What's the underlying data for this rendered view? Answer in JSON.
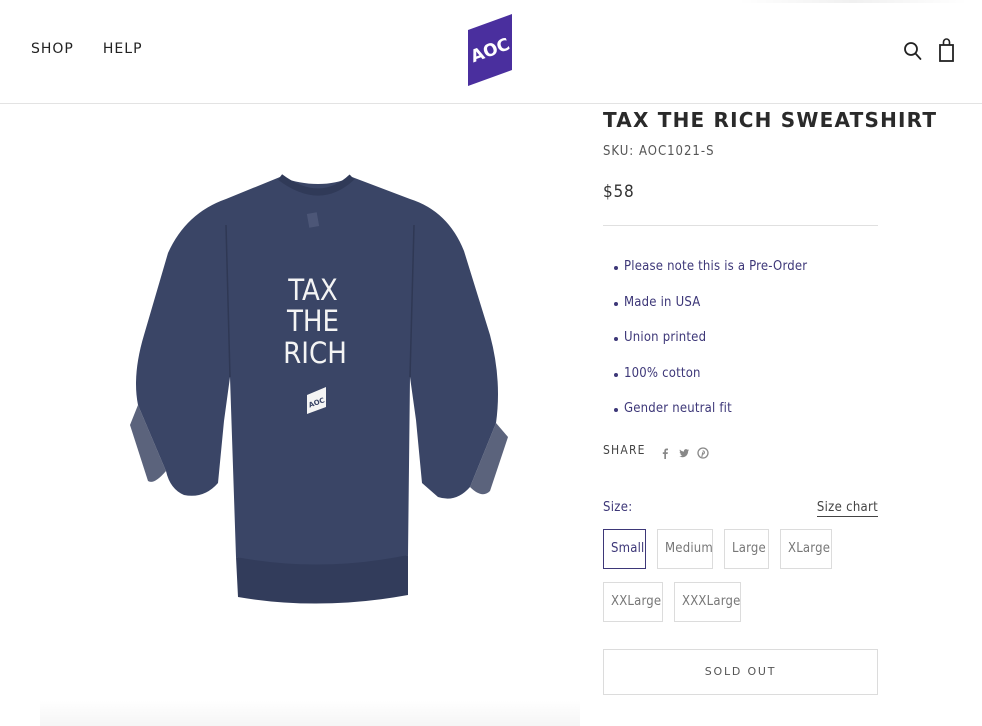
{
  "header": {
    "nav": [
      "SHOP",
      "HELP"
    ],
    "logo_text": "AOC",
    "icons": {
      "search": "search-icon",
      "cart": "shopping-bag-icon"
    }
  },
  "product": {
    "title": "TAX THE RICH SWEATSHIRT",
    "sku": "SKU: AOC1021-S",
    "price": "$58",
    "image": {
      "print_lines": [
        "TAX",
        "THE",
        "RICH"
      ],
      "badge_text": "AOC",
      "garment_color": "#3a4566"
    },
    "features": [
      "Please note this is a Pre-Order",
      "Made in USA",
      "Union printed",
      "100% cotton",
      "Gender neutral fit"
    ],
    "share": {
      "label": "SHARE",
      "icons": [
        "facebook-icon",
        "twitter-icon",
        "pinterest-icon"
      ]
    },
    "size": {
      "label": "Size:",
      "chart_link": "Size chart",
      "options": [
        "Small",
        "Medium",
        "Large",
        "XLarge",
        "XXLarge",
        "XXXLarge"
      ],
      "selected": "Small"
    },
    "button_label": "SOLD OUT"
  },
  "colors": {
    "brand": "#3d3778",
    "logo": "#4a2f9e",
    "text": "#2a2a2a",
    "border": "#dcdcdc"
  }
}
